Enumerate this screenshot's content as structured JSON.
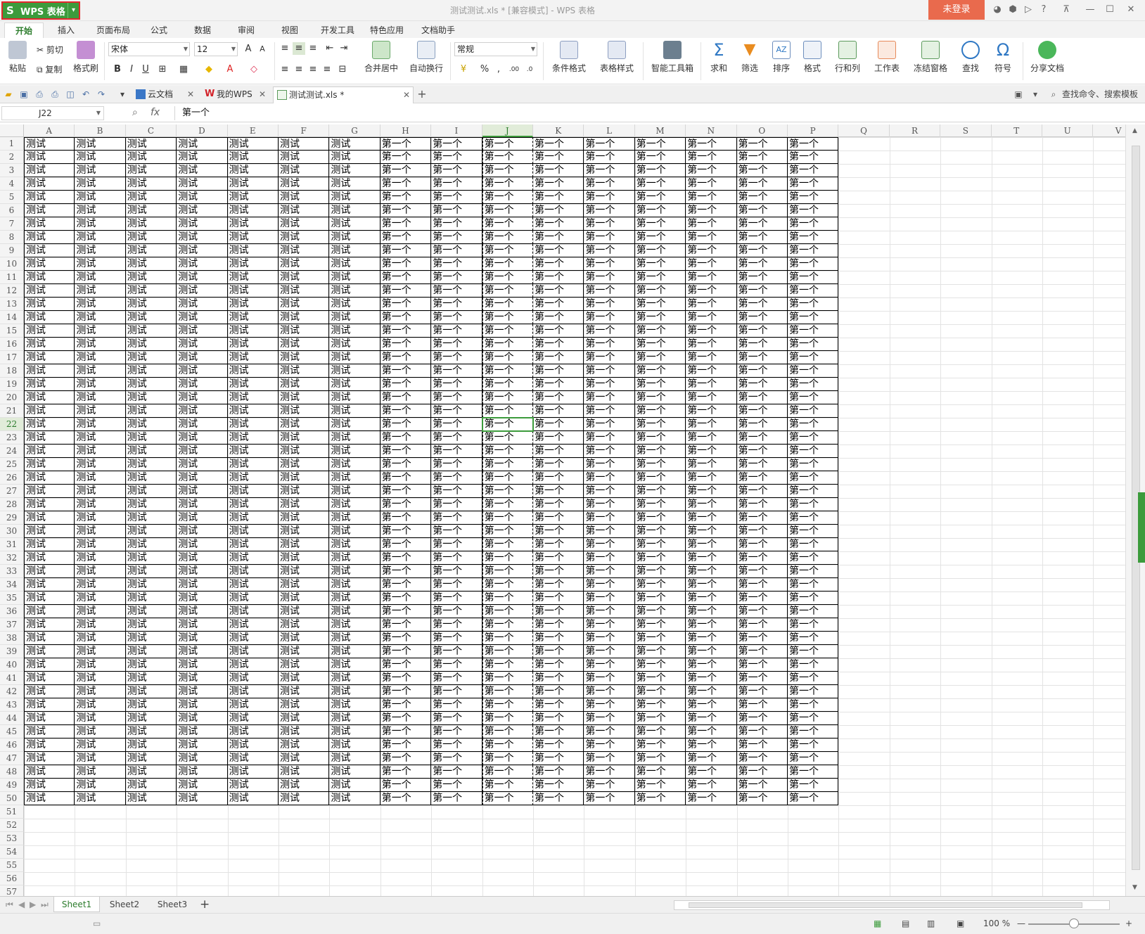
{
  "app": {
    "button_label": "WPS 表格",
    "document_title": "测试测试.xls * [兼容模式] - WPS 表格",
    "login_label": "未登录"
  },
  "ribbon_tabs": [
    "开始",
    "插入",
    "页面布局",
    "公式",
    "数据",
    "审阅",
    "视图",
    "开发工具",
    "特色应用",
    "文档助手"
  ],
  "ribbon": {
    "paste": "粘贴",
    "cut": "剪切",
    "copy": "复制",
    "format_painter": "格式刷",
    "font_name": "宋体",
    "font_size": "12",
    "merge_center": "合并居中",
    "wrap_text": "自动换行",
    "number_format": "常规",
    "conditional_format": "条件格式",
    "table_style": "表格样式",
    "smart_toolbox": "智能工具箱",
    "sum": "求和",
    "filter": "筛选",
    "sort": "排序",
    "format": "格式",
    "rows_cols": "行和列",
    "worksheet": "工作表",
    "freeze": "冻结窗格",
    "find": "查找",
    "symbol": "符号",
    "share": "分享文档"
  },
  "doc_tabs": [
    {
      "label": "云文档",
      "active": false
    },
    {
      "label": "我的WPS",
      "active": false
    },
    {
      "label": "测试测试.xls *",
      "active": true
    }
  ],
  "search_command": "查找命令、搜索模板",
  "formula_bar": {
    "name_box": "J22",
    "fx": "fx",
    "content": "第一个"
  },
  "columns": [
    "A",
    "B",
    "C",
    "D",
    "E",
    "F",
    "G",
    "H",
    "I",
    "J",
    "K",
    "L",
    "M",
    "N",
    "O",
    "P",
    "Q",
    "R",
    "S",
    "T",
    "U",
    "V"
  ],
  "selected_column": "J",
  "selected_row": 22,
  "row_count": 57,
  "data_rows": 50,
  "cell_text": {
    "text_cols": "测试",
    "num_cols": "第一个"
  },
  "sheets": [
    {
      "label": "Sheet1",
      "active": true
    },
    {
      "label": "Sheet2",
      "active": false
    },
    {
      "label": "Sheet3",
      "active": false
    }
  ],
  "status": {
    "zoom": "100 %"
  },
  "colors": {
    "accent": "#3c9b3c",
    "login": "#e96a4d"
  }
}
